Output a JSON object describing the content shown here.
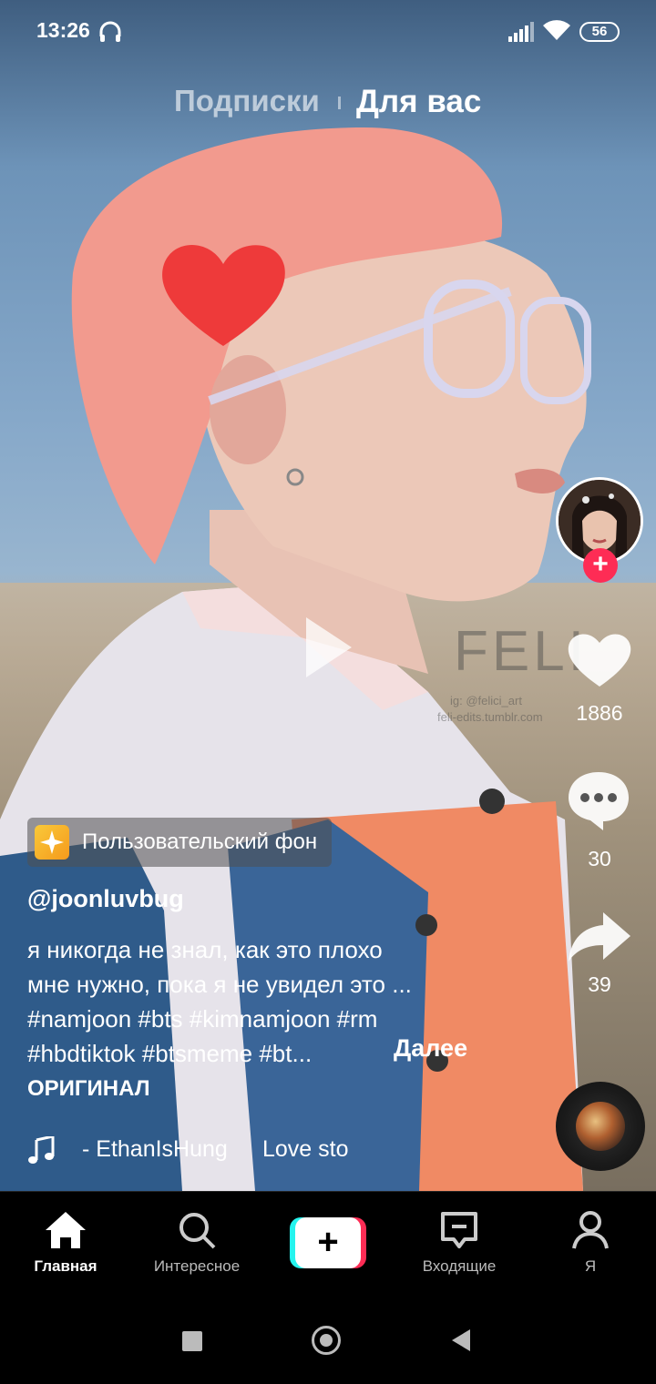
{
  "status_bar": {
    "time": "13:26",
    "battery": "56"
  },
  "top_tabs": {
    "following": "Подписки",
    "for_you": "Для вас"
  },
  "watermark": {
    "name": "FELI",
    "line1": "ig: @felici_art",
    "line2": "feli-edits.tumblr.com"
  },
  "side_actions": {
    "likes": "1886",
    "comments": "30",
    "shares": "39"
  },
  "effect": {
    "label": "Пользовательский фон"
  },
  "post": {
    "username": "@joonluvbug",
    "caption_lines": [
      "я никогда не знал, как это плохо",
      "мне нужно, пока я не увидел это ...",
      "#namjoon #bts #kimnamjoon #rm",
      "#hbdtiktok #btsmeme #bt..."
    ],
    "more": "Далее",
    "original": "ОРИГИНАЛ",
    "music_author": "- EthanIsHung",
    "music_title": "Love sto"
  },
  "nav": {
    "home": "Главная",
    "discover": "Интересное",
    "create": "+",
    "inbox": "Входящие",
    "me": "Я"
  },
  "colors": {
    "accent": "#fe2c55",
    "cyan": "#25f4ee"
  }
}
